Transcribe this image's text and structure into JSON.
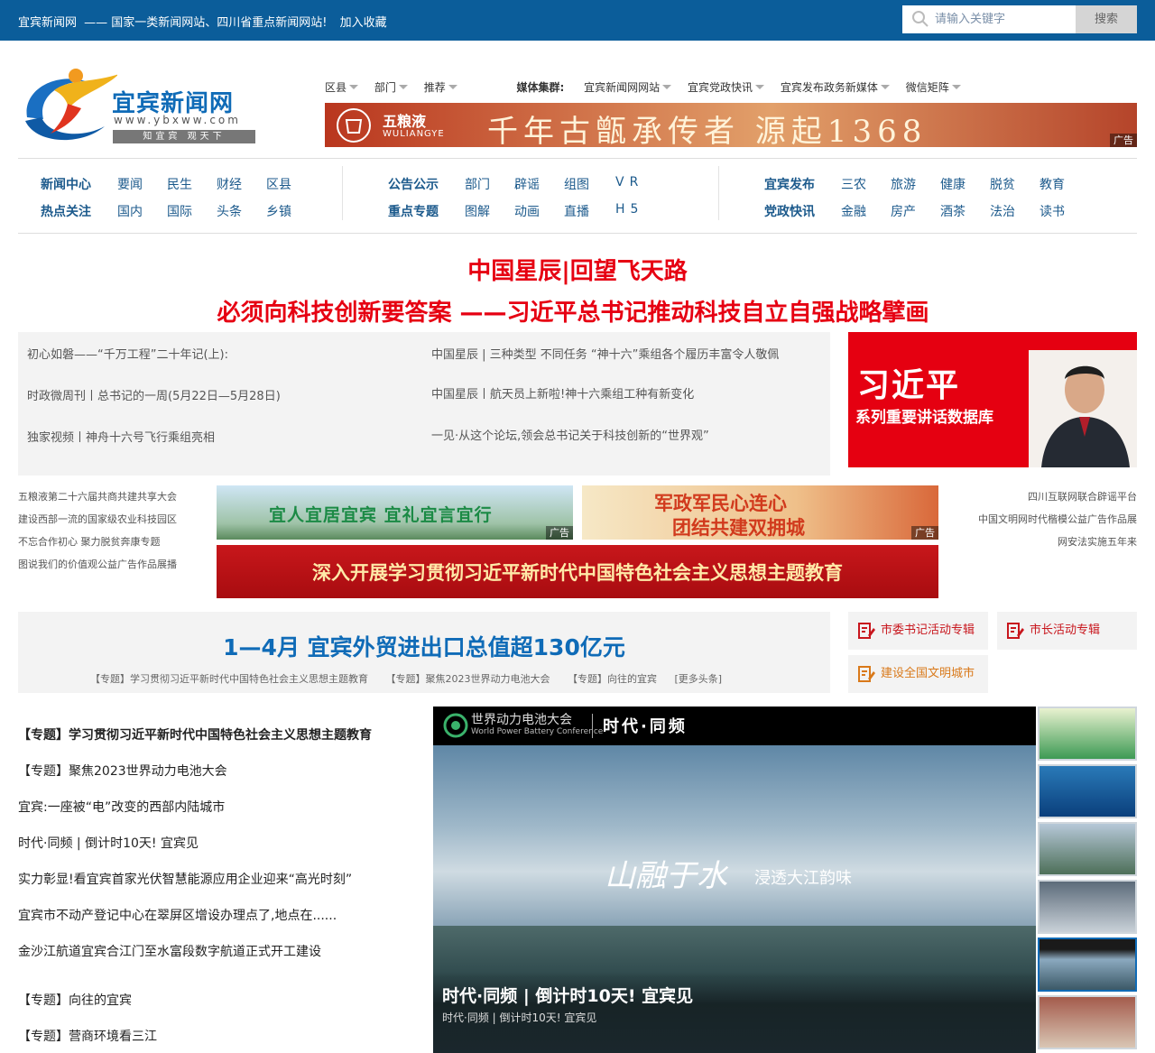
{
  "topbar": {
    "site_name": "宜宾新闻网",
    "tagline": "—— 国家一类新闻网站、四川省重点新闻网站!",
    "bookmark": "加入收藏",
    "search_placeholder": "请输入关键字",
    "search_button": "搜索"
  },
  "logo": {
    "name": "宜宾新闻网",
    "url": "www.ybxww.com",
    "motto": "知宜宾  观天下"
  },
  "header_nav": {
    "dropdowns_left": [
      "区县",
      "部门",
      "推荐"
    ],
    "media_label": "媒体集群:",
    "media_items": [
      "宜宾新闻网网站",
      "宜宾党政快讯",
      "宜宾发布政务新媒体",
      "微信矩阵"
    ]
  },
  "ad_wuliangye": {
    "brand": "五粮液",
    "brand_en": "WULIANGYE",
    "slogan": "千年古甑承传者 源起1368",
    "tag": "广告"
  },
  "main_nav": {
    "group1": {
      "row1": [
        "新闻中心",
        "要闻",
        "民生",
        "财经",
        "区县"
      ],
      "row2": [
        "热点关注",
        "国内",
        "国际",
        "头条",
        "乡镇"
      ]
    },
    "group2": {
      "row1": [
        "公告公示",
        "部门",
        "辟谣",
        "组图",
        "VR"
      ],
      "row2": [
        "重点专题",
        "图解",
        "动画",
        "直播",
        "H5"
      ]
    },
    "group3": {
      "row1": [
        "宜宾发布",
        "三农",
        "旅游",
        "健康",
        "脱贫",
        "教育"
      ],
      "row2": [
        "党政快讯",
        "金融",
        "房产",
        "酒茶",
        "法治",
        "读书"
      ]
    }
  },
  "headlines": {
    "line1": "中国星辰|回望飞天路",
    "line2": "必须向科技创新要答案 ——习近平总书记推动科技自立自强战略擘画"
  },
  "news_box": {
    "left": [
      "初心如磐——“千万工程”二十年记(上):",
      "时政微周刊丨总书记的一周(5月22日—5月28日)",
      "独家视频丨神舟十六号飞行乘组亮相"
    ],
    "right": [
      "中国星辰 | 三种类型 不同任务 “神十六”乘组各个履历丰富令人敬佩",
      "中国星辰丨航天员上新啦!神十六乘组工种有新变化",
      "一见·从这个论坛,领会总书记关于科技创新的“世界观”"
    ]
  },
  "xi_banner": {
    "title": "习近平",
    "subtitle": "系列重要讲话数据库"
  },
  "side_links_left": [
    "五粮液第二十六届共商共建共享大会",
    "建设西部一流的国家级农业科技园区",
    "不忘合作初心 聚力脱贫奔康专题",
    "图说我们的价值观公益广告作品展播"
  ],
  "side_links_right": [
    "四川互联网联合辟谣平台",
    "中国文明网时代楷模公益广告作品展",
    "网安法实施五年来"
  ],
  "ad_banners": {
    "green": "宜人宜居宜宾  宜礼宜言宜行",
    "army_line1": "军政军民心连心",
    "army_line2": "团结共建双拥城",
    "theme": "深入开展学习贯彻习近平新时代中国特色社会主义思想主题教育",
    "tag": "广告"
  },
  "topic_box": {
    "headline": "1—4月 宜宾外贸进出口总值超130亿元",
    "links": [
      "【专题】学习贯彻习近平新时代中国特色社会主义思想主题教育",
      "【专题】聚焦2023世界动力电池大会",
      "【专题】向往的宜宾",
      "[更多头条]"
    ]
  },
  "specials": [
    "市委书记活动专辑",
    "市长活动专辑",
    "建设全国文明城市"
  ],
  "left_list": [
    "【专题】学习贯彻习近平新时代中国特色社会主义思想主题教育",
    "【专题】聚焦2023世界动力电池大会",
    "宜宾:一座被“电”改变的西部内陆城市",
    "时代·同频 | 倒计时10天! 宜宾见",
    "实力彰显!看宜宾首家光伏智慧能源应用企业迎来“高光时刻”",
    "宜宾市不动产登记中心在翠屏区增设办理点了,地点在......",
    "金沙江航道宜宾合江门至水富段数字航道正式开工建设",
    "【专题】向往的宜宾",
    "【专题】营商环境看三江"
  ],
  "video": {
    "conf_cn": "世界动力电池大会",
    "conf_en": "World Power Battery Conference",
    "theme": "时代·同频",
    "calligraphy": "山融于水",
    "calligraphy2": "浸透大江韵味",
    "caption_title": "时代·同频 | 倒计时10天!  宜宾见",
    "caption_sub": "时代·同频 | 倒计时10天!  宜宾见"
  },
  "colors": {
    "topbar": "#0b5d9a",
    "headline_red": "#e60012",
    "nav_blue": "#1c5a8c",
    "topic_blue": "#0f6bb7"
  }
}
